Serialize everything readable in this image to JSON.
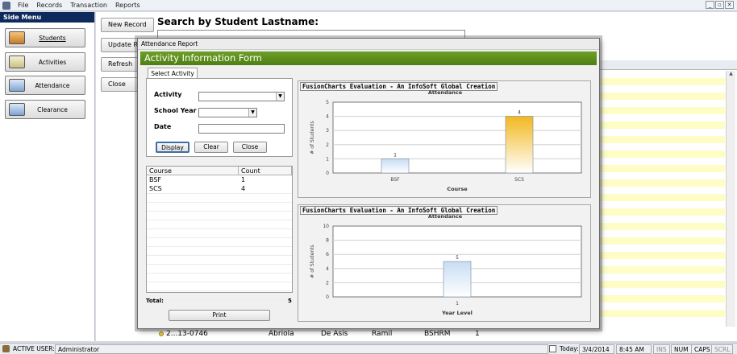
{
  "menubar": {
    "items": [
      "File",
      "Records",
      "Transaction",
      "Reports"
    ]
  },
  "window_controls": [
    "_",
    "▫",
    "✕"
  ],
  "side_menu": {
    "title": "Side Menu",
    "items": [
      {
        "label": "Students",
        "icon": "students-icon"
      },
      {
        "label": "Activities",
        "icon": "activities-icon"
      },
      {
        "label": "Attendance",
        "icon": "attendance-icon"
      },
      {
        "label": "Clearance",
        "icon": "clearance-icon"
      }
    ]
  },
  "main": {
    "buttons": [
      "New Record",
      "Update Re",
      "Refresh",
      "Close"
    ],
    "search_title": "Search by Student Lastname:",
    "search_value": "",
    "bottom_row": {
      "id": "2...13-0746",
      "lastname": "Abriola",
      "firstname": "De Asis",
      "middle": "Ramil",
      "course": "BSHRM",
      "year": "1"
    }
  },
  "dialog": {
    "caption": "Attendance Report",
    "form_title": "Activity Information Form",
    "tab": "Select Activity",
    "fields": {
      "activity_label": "Activity",
      "activity_value": "",
      "school_year_label": "School Year",
      "school_year_value": "",
      "date_label": "Date",
      "date_value": ""
    },
    "buttons": {
      "display": "Display",
      "clear": "Clear",
      "close": "Close",
      "print": "Print"
    },
    "table": {
      "columns": [
        "Course",
        "Count"
      ],
      "rows": [
        [
          "BSF",
          "1"
        ],
        [
          "SCS",
          "4"
        ]
      ]
    },
    "total_label": "Total:",
    "total_value": "5"
  },
  "chart_data": [
    {
      "type": "bar",
      "watermark": "FusionCharts Evaluation - An InfoSoft Global Creation",
      "title": "Attendance",
      "xlabel": "Course",
      "ylabel": "# of Students",
      "categories": [
        "BSF",
        "SCS"
      ],
      "values": [
        1,
        4
      ],
      "ylim": [
        0,
        5
      ],
      "yticks": [
        0,
        1,
        2,
        3,
        4,
        5
      ],
      "colors": [
        "#c7ddf3",
        "#f2b81f"
      ]
    },
    {
      "type": "bar",
      "watermark": "FusionCharts Evaluation - An InfoSoft Global Creation",
      "title": "Attendance",
      "xlabel": "Year Level",
      "ylabel": "# of Students",
      "categories": [
        "1"
      ],
      "values": [
        5
      ],
      "ylim": [
        0,
        10
      ],
      "yticks": [
        0,
        2,
        4,
        6,
        8,
        10
      ],
      "colors": [
        "#c7ddf3"
      ]
    }
  ],
  "statusbar": {
    "active_user_label": "ACTIVE USER:",
    "active_user": "Administrator",
    "today_label": "Today:",
    "today": "3/4/2014",
    "time": "8:45 AM",
    "ins": "INS",
    "num": "NUM",
    "caps": "CAPS",
    "scrl": "SCRL"
  },
  "colors": {
    "form_header": "#5b8c1d",
    "side_title": "#0e2a5c",
    "grid_stripe": "#fdfdc5"
  }
}
